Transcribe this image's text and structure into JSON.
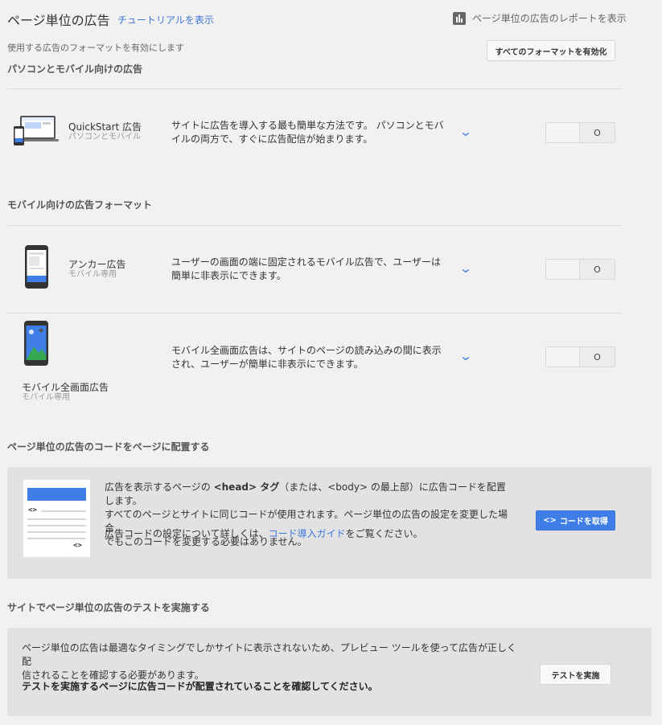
{
  "header": {
    "title": "ページ単位の広告",
    "tutorial_link": "チュートリアルを表示",
    "report_link": "ページ単位の広告のレポートを表示"
  },
  "intro": {
    "description": "使用する広告のフォーマットを有効にします",
    "enable_all_label": "すべてのフォーマットを有効化"
  },
  "sections": {
    "desktop_mobile_heading": "パソコンとモバイル向けの広告",
    "mobile_heading": "モバイル向けの広告フォーマット",
    "code_heading": "ページ単位の広告のコードをページに配置する",
    "test_heading": "サイトでページ単位の広告のテストを実施する"
  },
  "formats": [
    {
      "name": "QuickStart 広告",
      "sub": "パソコンとモバイル",
      "desc_line1": "サイトに広告を導入する最も簡単な方法です。 パソコンとモバ",
      "desc_line2": "イルの両方で、すぐに広告配信が始まります。",
      "toggle_state": "O"
    },
    {
      "name": "アンカー広告",
      "sub": "モバイル専用",
      "desc_line1": "ユーザーの画面の端に固定されるモバイル広告で、ユーザーは",
      "desc_line2": "簡単に非表示にできます。",
      "toggle_state": "O"
    },
    {
      "name": "モバイル全画面広告",
      "sub": "モバイル専用",
      "desc_line1": "モバイル全画面広告は、サイトのページの読み込みの間に表示",
      "desc_line2": "され、ユーザーが簡単に非表示にできます。",
      "toggle_state": "O"
    }
  ],
  "code_panel": {
    "line1_pre": "広告を表示するページの ",
    "line1_head": "<head> タグ",
    "line1_post": "（または、<body> の最上部）に広告コードを配置します。",
    "line2": "すべてのページとサイトに同じコードが使用されます。ページ単位の広告の設定を変更した場合",
    "line3": "でもこのコードを変更する必要はありません。",
    "guide_pre": "広告コードの設定について詳しくは、",
    "guide_link": "コード導入ガイド",
    "guide_post": "をご覧ください。",
    "get_code_label": "コードを取得",
    "code_symbol": "<>"
  },
  "test_panel": {
    "line1": "ページ単位の広告は最適なタイミングでしかサイトに表示されないため、プレビュー ツールを使って広告が正しく配",
    "line2": "信されることを確認する必要があります。",
    "bold": "テストを実施するページに広告コードが配置されていることを確認してください。",
    "test_button_label": "テストを実施"
  },
  "colors": {
    "accent": "#3f7ee6",
    "link": "#3f76d9",
    "background": "#f1f1f1",
    "panel": "#e2e2e2"
  }
}
